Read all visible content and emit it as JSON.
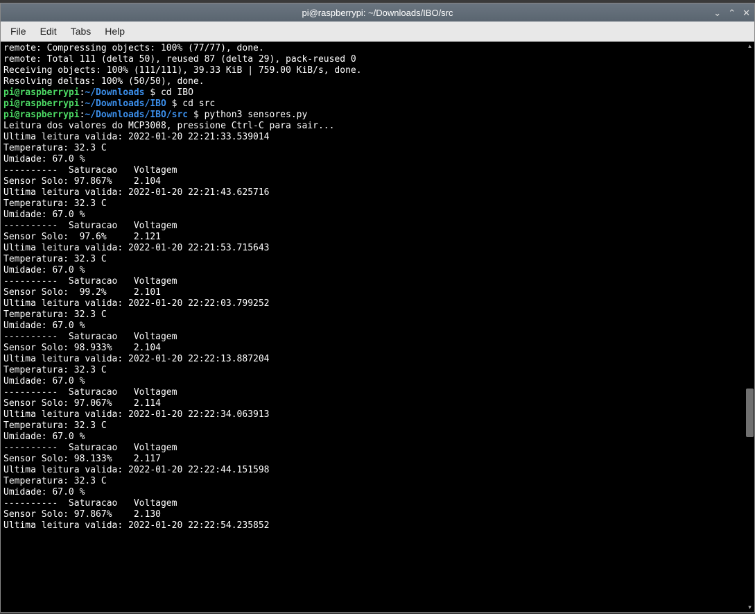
{
  "window": {
    "title": "pi@raspberrypi: ~/Downloads/IBO/src"
  },
  "menu": {
    "file": "File",
    "edit": "Edit",
    "tabs": "Tabs",
    "help": "Help"
  },
  "prompt": {
    "userhost": "pi@raspberrypi",
    "colon": ":",
    "dollar": " $ "
  },
  "prompts": [
    {
      "path": "~/Downloads",
      "cmd": "cd IBO"
    },
    {
      "path": "~/Downloads/IBO",
      "cmd": "cd src"
    },
    {
      "path": "~/Downloads/IBO/src",
      "cmd": "python3 sensores.py"
    }
  ],
  "preamble": [
    "remote: Compressing objects: 100% (77/77), done.",
    "remote: Total 111 (delta 50), reused 87 (delta 29), pack-reused 0",
    "Receiving objects: 100% (111/111), 39.33 KiB | 759.00 KiB/s, done.",
    "Resolving deltas: 100% (50/50), done."
  ],
  "intro": "Leitura dos valores do MCP3008, pressione Ctrl-C para sair...",
  "readings": [
    {
      "ts": "Ultima leitura valida: 2022-01-20 22:21:33.539014",
      "temp": "Temperatura: 32.3 C",
      "hum": "Umidade: 67.0 %",
      "hdr": "----------  Saturacao   Voltagem",
      "sensor": "Sensor Solo: 97.867%    2.104"
    },
    {
      "ts": "Ultima leitura valida: 2022-01-20 22:21:43.625716",
      "temp": "Temperatura: 32.3 C",
      "hum": "Umidade: 67.0 %",
      "hdr": "----------  Saturacao   Voltagem",
      "sensor": "Sensor Solo:  97.6%     2.121"
    },
    {
      "ts": "Ultima leitura valida: 2022-01-20 22:21:53.715643",
      "temp": "Temperatura: 32.3 C",
      "hum": "Umidade: 67.0 %",
      "hdr": "----------  Saturacao   Voltagem",
      "sensor": "Sensor Solo:  99.2%     2.101"
    },
    {
      "ts": "Ultima leitura valida: 2022-01-20 22:22:03.799252",
      "temp": "Temperatura: 32.3 C",
      "hum": "Umidade: 67.0 %",
      "hdr": "----------  Saturacao   Voltagem",
      "sensor": "Sensor Solo: 98.933%    2.104"
    },
    {
      "ts": "Ultima leitura valida: 2022-01-20 22:22:13.887204",
      "temp": "Temperatura: 32.3 C",
      "hum": "Umidade: 67.0 %",
      "hdr": "----------  Saturacao   Voltagem",
      "sensor": "Sensor Solo: 97.067%    2.114"
    },
    {
      "ts": "Ultima leitura valida: 2022-01-20 22:22:34.063913",
      "temp": "Temperatura: 32.3 C",
      "hum": "Umidade: 67.0 %",
      "hdr": "----------  Saturacao   Voltagem",
      "sensor": "Sensor Solo: 98.133%    2.117"
    },
    {
      "ts": "Ultima leitura valida: 2022-01-20 22:22:44.151598",
      "temp": "Temperatura: 32.3 C",
      "hum": "Umidade: 67.0 %",
      "hdr": "----------  Saturacao   Voltagem",
      "sensor": "Sensor Solo: 97.867%    2.130"
    }
  ],
  "tail": "Ultima leitura valida: 2022-01-20 22:22:54.235852"
}
